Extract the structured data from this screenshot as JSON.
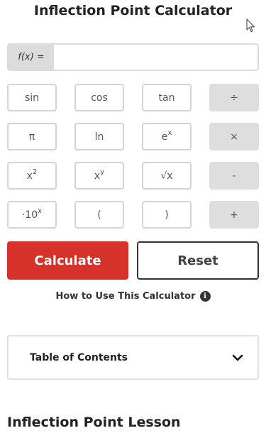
{
  "header": {
    "title": "Inflection Point Calculator"
  },
  "input": {
    "label": "f(x) =",
    "value": "",
    "placeholder": ""
  },
  "keypad": {
    "keys": [
      {
        "label": "sin",
        "sup": ""
      },
      {
        "label": "cos",
        "sup": ""
      },
      {
        "label": "tan",
        "sup": ""
      },
      {
        "label": "÷",
        "sup": ""
      },
      {
        "label": "π",
        "sup": ""
      },
      {
        "label": "ln",
        "sup": ""
      },
      {
        "label": "e",
        "sup": "x"
      },
      {
        "label": "×",
        "sup": ""
      },
      {
        "label": "x",
        "sup": "2"
      },
      {
        "label": "x",
        "sup": "y"
      },
      {
        "label": "√x",
        "sup": ""
      },
      {
        "label": "-",
        "sup": ""
      },
      {
        "label": "·10",
        "sup": "x"
      },
      {
        "label": "(",
        "sup": ""
      },
      {
        "label": ")",
        "sup": ""
      },
      {
        "label": "+",
        "sup": ""
      }
    ]
  },
  "actions": {
    "calculate_label": "Calculate",
    "reset_label": "Reset",
    "accent_color": "#d6322a"
  },
  "help": {
    "text": "How to Use This Calculator",
    "icon": "info-icon"
  },
  "toc": {
    "label": "Table of Contents",
    "icon": "chevron-down-icon"
  },
  "lesson": {
    "title": "Inflection Point Lesson"
  }
}
